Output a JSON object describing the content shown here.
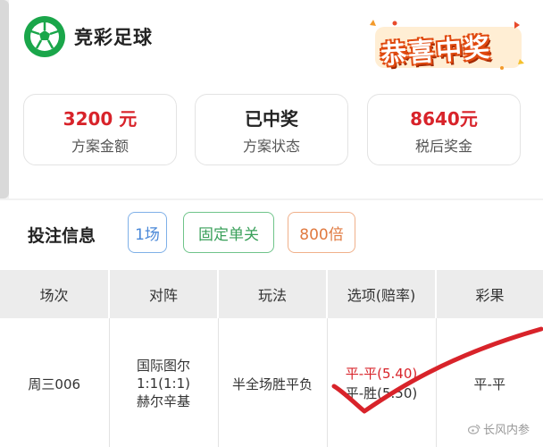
{
  "header": {
    "app_title": "竞彩足球",
    "prize_badge": "恭喜中奖"
  },
  "stats": [
    {
      "value": "3200 元",
      "label": "方案金额"
    },
    {
      "value": "已中奖",
      "label": "方案状态"
    },
    {
      "value": "8640元",
      "label": "税后奖金"
    }
  ],
  "bet_info": {
    "title": "投注信息",
    "tags": [
      "1场",
      "固定单关",
      "800倍"
    ]
  },
  "table": {
    "headers": [
      "场次",
      "对阵",
      "玩法",
      "选项(赔率)",
      "彩果"
    ],
    "row": {
      "match_no": "周三006",
      "home": "国际图尔",
      "score": "1:1(1:1)",
      "away": "赫尔辛基",
      "play": "半全场胜平负",
      "option1": "平-平(5.40)",
      "option2": "平-胜(5.50)",
      "result": "平-平"
    }
  },
  "watermark": "长风内参",
  "colors": {
    "accent_red": "#d8232a",
    "brand_green": "#1aa64a",
    "check_red": "#d8232a"
  }
}
